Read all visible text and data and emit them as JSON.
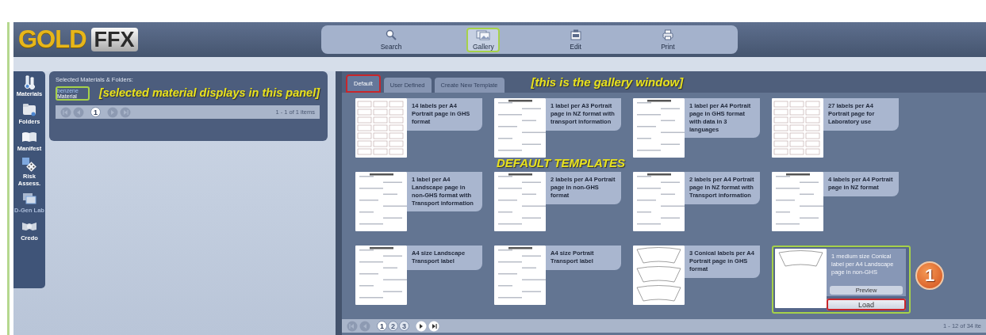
{
  "logo": {
    "gold": "GOLD",
    "ffx": "FFX"
  },
  "toolbar": [
    {
      "label": "Search",
      "selected": false,
      "outlined": false
    },
    {
      "label": "Gallery",
      "selected": true,
      "outlined": true
    },
    {
      "label": "Edit",
      "selected": false,
      "outlined": false
    },
    {
      "label": "Print",
      "selected": false,
      "outlined": false
    }
  ],
  "sidebar": {
    "items": [
      {
        "label": "Materials",
        "disabled": false
      },
      {
        "label": "Folders",
        "disabled": false
      },
      {
        "label": "Manifest",
        "disabled": false
      },
      {
        "label": "Risk Assess.",
        "disabled": false
      },
      {
        "label": "D-Gen Lab",
        "disabled": true
      },
      {
        "label": "Credo",
        "disabled": false
      }
    ]
  },
  "materials_panel": {
    "title": "Selected Materials & Folders:",
    "items": [
      {
        "name": "benzene",
        "type": "Material",
        "outlined": true
      }
    ],
    "note": "[selected material displays in this panel]",
    "pager": {
      "back_disabled": true,
      "forward_disabled": true,
      "pages": [
        {
          "label": "1",
          "selected": true
        }
      ],
      "summary": "1 - 1 of 1 items"
    }
  },
  "gallery": {
    "tabs": [
      {
        "label": "Default",
        "selected": true,
        "outlined": true
      },
      {
        "label": "User Defined",
        "selected": false,
        "outlined": false
      },
      {
        "label": "Create New Template",
        "selected": false,
        "outlined": false
      }
    ],
    "note": "[this is the gallery window]",
    "section_note": "DEFAULT TEMPLATES",
    "templates": [
      {
        "description": "14 labels per A4 Portrait page in GHS format",
        "selected": false,
        "outlined": false
      },
      {
        "description": "1 label per A3 Portrait page in NZ format with transport information",
        "selected": false,
        "outlined": false
      },
      {
        "description": "1 label per A4 Portrait page in GHS format with data in 3 languages",
        "selected": false,
        "outlined": false
      },
      {
        "description": "27 labels per A4 Portrait page for Laboratory use",
        "selected": false,
        "outlined": false
      },
      {
        "description": "1 label per A4 Landscape page in non-GHS format with Transport information",
        "selected": false,
        "outlined": false
      },
      {
        "description": "2 labels per A4 Portrait page in non-GHS format",
        "selected": false,
        "outlined": false
      },
      {
        "description": "2 labels per A4 Portrait page in NZ format with Transport information",
        "selected": false,
        "outlined": false
      },
      {
        "description": "4 labels per A4 Portrait page in NZ format",
        "selected": false,
        "outlined": false
      },
      {
        "description": "A4 size Landscape Transport label",
        "selected": false,
        "outlined": false
      },
      {
        "description": "A4 size Portrait Transport label",
        "selected": false,
        "outlined": false
      },
      {
        "description": "3 Conical labels per A4 Portrait page in GHS format",
        "selected": false,
        "outlined": false
      },
      {
        "description": "1 medium size Conical label per A4 Landscape page in non-GHS",
        "selected": true,
        "outlined": true
      }
    ],
    "preview_button": "Preview",
    "load_button": {
      "label": "Load",
      "outlined": true
    },
    "step_badge": "1",
    "pager": {
      "back_disabled": true,
      "forward_disabled": false,
      "pages": [
        {
          "label": "1",
          "selected": true
        },
        {
          "label": "2",
          "selected": false
        },
        {
          "label": "3",
          "selected": false
        }
      ],
      "summary": "1 - 12 of 34 ite"
    }
  }
}
